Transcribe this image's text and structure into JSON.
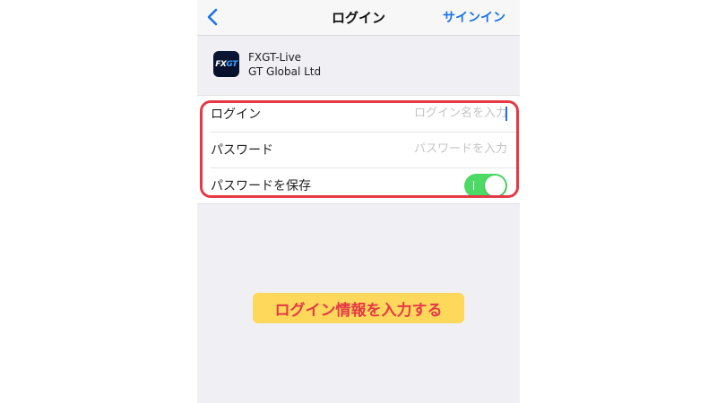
{
  "navbar": {
    "back_icon": "chevron-left-icon",
    "title": "ログイン",
    "action_label": "サインイン",
    "accent_color": "#1a73e8"
  },
  "server": {
    "logo_text_white": "FX",
    "logo_text_blue": "GT",
    "name": "FXGT-Live",
    "company": "GT Global Ltd"
  },
  "form": {
    "login": {
      "label": "ログイン",
      "value": "",
      "placeholder": "ログイン名を入力"
    },
    "password": {
      "label": "パスワード",
      "value": "",
      "placeholder": "パスワードを入力"
    },
    "save_password": {
      "label": "パスワードを保存",
      "toggle_state": "on",
      "toggle_color": "#4cd964"
    }
  },
  "annotation": {
    "callout_text": "ログイン情報を入力する",
    "highlight_color": "#e63946",
    "callout_bg": "#fdd85a"
  }
}
